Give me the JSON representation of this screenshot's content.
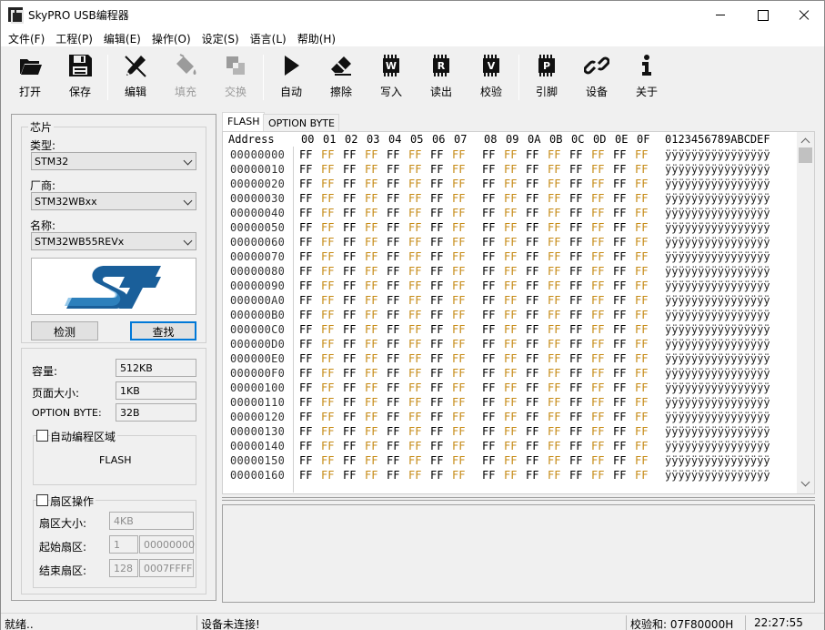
{
  "window": {
    "title": "SkyPRO USB编程器",
    "controls": {
      "minimize": "minimize",
      "maximize": "maximize",
      "close": "close"
    }
  },
  "menu": [
    {
      "label": "文件(F)"
    },
    {
      "label": "工程(P)"
    },
    {
      "label": "编辑(E)"
    },
    {
      "label": "操作(O)"
    },
    {
      "label": "设定(S)"
    },
    {
      "label": "语言(L)"
    },
    {
      "label": "帮助(H)"
    }
  ],
  "toolbar": {
    "open": {
      "label": "打开",
      "icon": "folder-open-icon"
    },
    "save": {
      "label": "保存",
      "icon": "save-disk-icon"
    },
    "edit": {
      "label": "编辑",
      "icon": "pen-edit-icon"
    },
    "fill": {
      "label": "填充",
      "icon": "paint-bucket-icon",
      "disabled": true
    },
    "swap": {
      "label": "交换",
      "icon": "swap-icon",
      "disabled": true
    },
    "auto": {
      "label": "自动",
      "icon": "play-icon"
    },
    "erase": {
      "label": "擦除",
      "icon": "eraser-icon"
    },
    "write": {
      "label": "写入",
      "icon": "chip-w-icon",
      "chip_letter": "W"
    },
    "read": {
      "label": "读出",
      "icon": "chip-r-icon",
      "chip_letter": "R"
    },
    "verify": {
      "label": "校验",
      "icon": "chip-v-icon",
      "chip_letter": "V"
    },
    "pins": {
      "label": "引脚",
      "icon": "chip-p-icon",
      "chip_letter": "P"
    },
    "device": {
      "label": "设备",
      "icon": "link-chain-icon"
    },
    "about": {
      "label": "关于",
      "icon": "info-icon"
    }
  },
  "chip_panel": {
    "group_title": "芯片",
    "type_label": "类型:",
    "type_value": "STM32",
    "vendor_label": "厂商:",
    "vendor_value": "STM32WBxx",
    "name_label": "名称:",
    "name_value": "STM32WB55REVx",
    "logo": "st-logo",
    "detect_button": "检测",
    "find_button": "查找"
  },
  "info_panel": {
    "capacity_label": "容量:",
    "capacity_value": "512KB",
    "page_size_label": "页面大小:",
    "page_size_value": "1KB",
    "option_byte_label": "OPTION BYTE:",
    "option_byte_value": "32B",
    "auto_region_label": "自动编程区域",
    "auto_region_checked": false,
    "region_value": "FLASH",
    "sector_ops_label": "扇区操作",
    "sector_ops_checked": false,
    "sector_size_label": "扇区大小:",
    "sector_size_value": "4KB",
    "start_sector_label": "起始扇区:",
    "start_sector_index": "1",
    "start_sector_addr": "00000000",
    "end_sector_label": "结束扇区:",
    "end_sector_index": "128",
    "end_sector_addr": "0007FFFF"
  },
  "tabs": [
    {
      "label": "FLASH",
      "active": true
    },
    {
      "label": "OPTION BYTE",
      "active": false
    }
  ],
  "hex_view": {
    "address_header": "Address",
    "columns": [
      "00",
      "01",
      "02",
      "03",
      "04",
      "05",
      "06",
      "07",
      "08",
      "09",
      "0A",
      "0B",
      "0C",
      "0D",
      "0E",
      "0F"
    ],
    "ascii_header": "0123456789ABCDEF",
    "rows": [
      {
        "addr": "00000000",
        "bytes": "FF",
        "ascii": "ÿÿÿÿÿÿÿÿÿÿÿÿÿÿÿÿ"
      },
      {
        "addr": "00000010",
        "bytes": "FF",
        "ascii": "ÿÿÿÿÿÿÿÿÿÿÿÿÿÿÿÿ"
      },
      {
        "addr": "00000020",
        "bytes": "FF",
        "ascii": "ÿÿÿÿÿÿÿÿÿÿÿÿÿÿÿÿ"
      },
      {
        "addr": "00000030",
        "bytes": "FF",
        "ascii": "ÿÿÿÿÿÿÿÿÿÿÿÿÿÿÿÿ"
      },
      {
        "addr": "00000040",
        "bytes": "FF",
        "ascii": "ÿÿÿÿÿÿÿÿÿÿÿÿÿÿÿÿ"
      },
      {
        "addr": "00000050",
        "bytes": "FF",
        "ascii": "ÿÿÿÿÿÿÿÿÿÿÿÿÿÿÿÿ"
      },
      {
        "addr": "00000060",
        "bytes": "FF",
        "ascii": "ÿÿÿÿÿÿÿÿÿÿÿÿÿÿÿÿ"
      },
      {
        "addr": "00000070",
        "bytes": "FF",
        "ascii": "ÿÿÿÿÿÿÿÿÿÿÿÿÿÿÿÿ"
      },
      {
        "addr": "00000080",
        "bytes": "FF",
        "ascii": "ÿÿÿÿÿÿÿÿÿÿÿÿÿÿÿÿ"
      },
      {
        "addr": "00000090",
        "bytes": "FF",
        "ascii": "ÿÿÿÿÿÿÿÿÿÿÿÿÿÿÿÿ"
      },
      {
        "addr": "000000A0",
        "bytes": "FF",
        "ascii": "ÿÿÿÿÿÿÿÿÿÿÿÿÿÿÿÿ"
      },
      {
        "addr": "000000B0",
        "bytes": "FF",
        "ascii": "ÿÿÿÿÿÿÿÿÿÿÿÿÿÿÿÿ"
      },
      {
        "addr": "000000C0",
        "bytes": "FF",
        "ascii": "ÿÿÿÿÿÿÿÿÿÿÿÿÿÿÿÿ"
      },
      {
        "addr": "000000D0",
        "bytes": "FF",
        "ascii": "ÿÿÿÿÿÿÿÿÿÿÿÿÿÿÿÿ"
      },
      {
        "addr": "000000E0",
        "bytes": "FF",
        "ascii": "ÿÿÿÿÿÿÿÿÿÿÿÿÿÿÿÿ"
      },
      {
        "addr": "000000F0",
        "bytes": "FF",
        "ascii": "ÿÿÿÿÿÿÿÿÿÿÿÿÿÿÿÿ"
      },
      {
        "addr": "00000100",
        "bytes": "FF",
        "ascii": "ÿÿÿÿÿÿÿÿÿÿÿÿÿÿÿÿ"
      },
      {
        "addr": "00000110",
        "bytes": "FF",
        "ascii": "ÿÿÿÿÿÿÿÿÿÿÿÿÿÿÿÿ"
      },
      {
        "addr": "00000120",
        "bytes": "FF",
        "ascii": "ÿÿÿÿÿÿÿÿÿÿÿÿÿÿÿÿ"
      },
      {
        "addr": "00000130",
        "bytes": "FF",
        "ascii": "ÿÿÿÿÿÿÿÿÿÿÿÿÿÿÿÿ"
      },
      {
        "addr": "00000140",
        "bytes": "FF",
        "ascii": "ÿÿÿÿÿÿÿÿÿÿÿÿÿÿÿÿ"
      },
      {
        "addr": "00000150",
        "bytes": "FF",
        "ascii": "ÿÿÿÿÿÿÿÿÿÿÿÿÿÿÿÿ"
      },
      {
        "addr": "00000160",
        "bytes": "FF",
        "ascii": "ÿÿÿÿÿÿÿÿÿÿÿÿÿÿÿÿ"
      }
    ],
    "odd_column_color": "#c68a15"
  },
  "status_bar": {
    "state": "就绪..",
    "connection": "设备未连接!",
    "checksum": "校验和: 07F80000H",
    "time": "22:27:55"
  },
  "colors": {
    "st_logo_blue": "#1a5f9a",
    "st_logo_light": "#3e9ad8",
    "focus_blue": "#0078d7"
  }
}
